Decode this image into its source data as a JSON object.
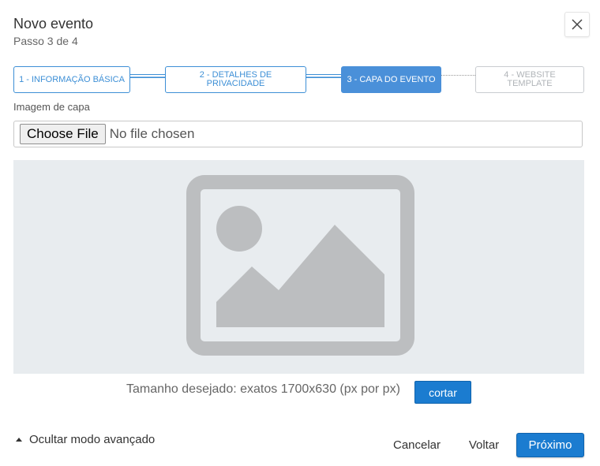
{
  "header": {
    "title": "Novo evento",
    "subtitle": "Passo 3 de 4",
    "close_icon": "close-icon"
  },
  "stepper": {
    "steps": [
      {
        "label": "1 - INFORMAÇÃO BÁSICA",
        "state": "done"
      },
      {
        "label": "2 - DETALHES DE PRIVACIDADE",
        "state": "done"
      },
      {
        "label": "3 - CAPA DO EVENTO",
        "state": "active"
      },
      {
        "label": "4 - WEBSITE TEMPLATE",
        "state": "todo"
      }
    ]
  },
  "cover": {
    "label": "Imagem de capa",
    "file_button": "Choose File",
    "file_status": "No file chosen",
    "placeholder_icon": "image-placeholder-icon",
    "size_hint": "Tamanho desejado: exatos 1700x630 (px por px)",
    "crop_button": "cortar"
  },
  "footer": {
    "advanced_toggle": "Ocultar modo avançado",
    "cancel": "Cancelar",
    "back": "Voltar",
    "next": "Próximo"
  },
  "colors": {
    "accent": "#1b7cd0",
    "step_done": "#3d8fd6",
    "step_active": "#4a90d9",
    "placeholder_bg": "#e8ecef",
    "placeholder_icon": "#bcbec0"
  }
}
